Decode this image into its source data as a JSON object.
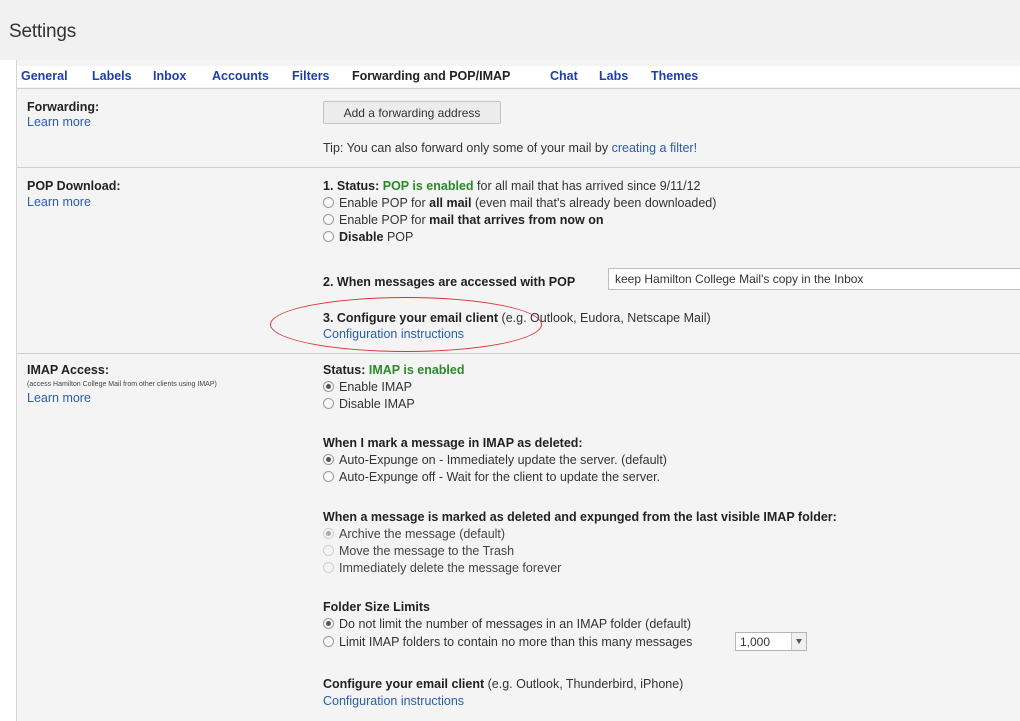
{
  "page": {
    "title": "Settings"
  },
  "tabs": [
    {
      "label": "General"
    },
    {
      "label": "Labels"
    },
    {
      "label": "Inbox"
    },
    {
      "label": "Accounts"
    },
    {
      "label": "Filters"
    },
    {
      "label": "Forwarding and POP/IMAP",
      "active": true
    },
    {
      "label": "Chat"
    },
    {
      "label": "Labs"
    },
    {
      "label": "Themes"
    }
  ],
  "forwarding": {
    "title": "Forwarding:",
    "learn_more": "Learn more",
    "add_button": "Add a forwarding address",
    "tip_prefix": "Tip: You can also forward only some of your mail by",
    "tip_link": "creating a filter!"
  },
  "pop": {
    "title": "POP Download:",
    "learn_more": "Learn more",
    "status_label": "1. Status:",
    "status_value": "POP is enabled",
    "status_suffix": "for all mail that has arrived since 9/11/12",
    "opt1_pre": "Enable POP for",
    "opt1_bold": "all mail",
    "opt1_post": "(even mail that's already been downloaded)",
    "opt2_pre": "Enable POP for",
    "opt2_bold": "mail that arrives from now on",
    "opt3_bold": "Disable",
    "opt3_post": "POP",
    "access_label": "2. When messages are accessed with POP",
    "access_value": "keep Hamilton College Mail's copy in the Inbox",
    "config_label": "3. Configure your email client",
    "config_suffix": "(e.g. Outlook, Eudora, Netscape Mail)",
    "config_link": "Configuration instructions"
  },
  "imap": {
    "title": "IMAP Access:",
    "desc": "(access Hamilton College Mail from other clients using IMAP)",
    "learn_more": "Learn more",
    "status_label": "Status:",
    "status_value": "IMAP is enabled",
    "enable": "Enable IMAP",
    "disable": "Disable IMAP",
    "deleted_heading": "When I mark a message in IMAP as deleted:",
    "expunge_on": "Auto-Expunge on - Immediately update the server. (default)",
    "expunge_off": "Auto-Expunge off - Wait for the client to update the server.",
    "expunged_heading": "When a message is marked as deleted and expunged from the last visible IMAP folder:",
    "archive": "Archive the message (default)",
    "trash": "Move the message to the Trash",
    "delete_forever": "Immediately delete the message forever",
    "folder_heading": "Folder Size Limits",
    "no_limit": "Do not limit the number of messages in an IMAP folder (default)",
    "limit": "Limit IMAP folders to contain no more than this many messages",
    "limit_value": "1,000",
    "config_label": "Configure your email client",
    "config_suffix": "(e.g. Outlook, Thunderbird, iPhone)",
    "config_link": "Configuration instructions"
  },
  "colors": {
    "link": "#2a5db0",
    "status_green": "#2b8a2b",
    "annotation": "#dd3333"
  }
}
